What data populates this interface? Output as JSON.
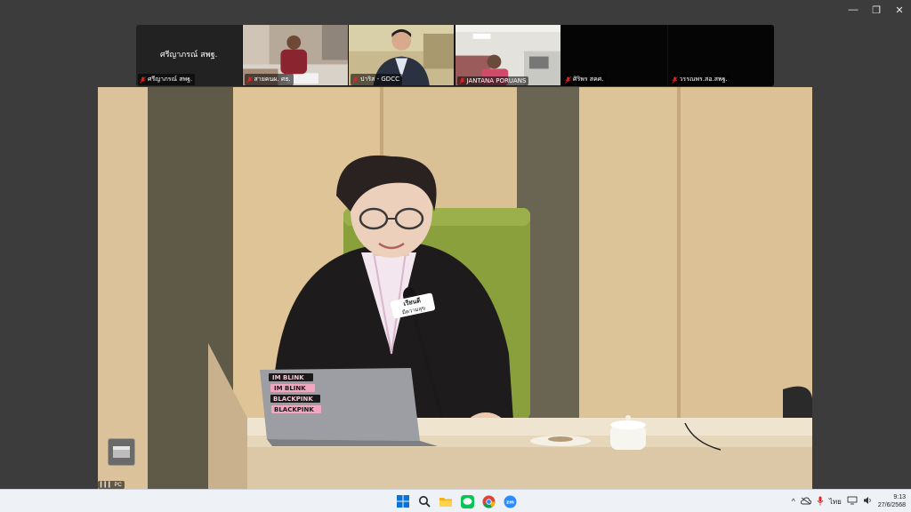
{
  "window": {
    "minimize": "—",
    "restore": "❐",
    "close": "✕"
  },
  "participants": [
    {
      "tile_text": "ศรีญาภรณ์ สพฐ.",
      "name": "ศรีญาภรณ์ สพฐ."
    },
    {
      "tile_text": "",
      "name": "สายคนผ. ศธ."
    },
    {
      "tile_text": "",
      "name": "ปาริส - GDCC"
    },
    {
      "tile_text": "",
      "name": "JANTANA PORUANS"
    },
    {
      "tile_text": "",
      "name": "ศิริพร สคศ."
    },
    {
      "tile_text": "",
      "name": "วรรณพร.สอ.สพฐ."
    }
  ],
  "main_video": {
    "mic_sign_line1": "เรียนดี",
    "mic_sign_line2": "มีความสุข",
    "laptop_stickers": [
      "IM BLINK",
      "IM BLINK",
      "BLACKPINK",
      "BLACKPINK"
    ],
    "signal_label": "▎▎▎ PC"
  },
  "taskbar": {
    "apps": [
      "windows-start",
      "search",
      "file-explorer",
      "line",
      "chrome",
      "zoom"
    ],
    "zoom_label": "zm",
    "tray_chevron": "^",
    "tray_lang": "ไทย",
    "clock_time": "9:13",
    "clock_date": "27/6/2568"
  },
  "colors": {
    "mic_muted": "#e02525",
    "zoom_blue": "#2d8cff",
    "line_green": "#06c755",
    "taskbar_bg": "#eef1f5"
  }
}
